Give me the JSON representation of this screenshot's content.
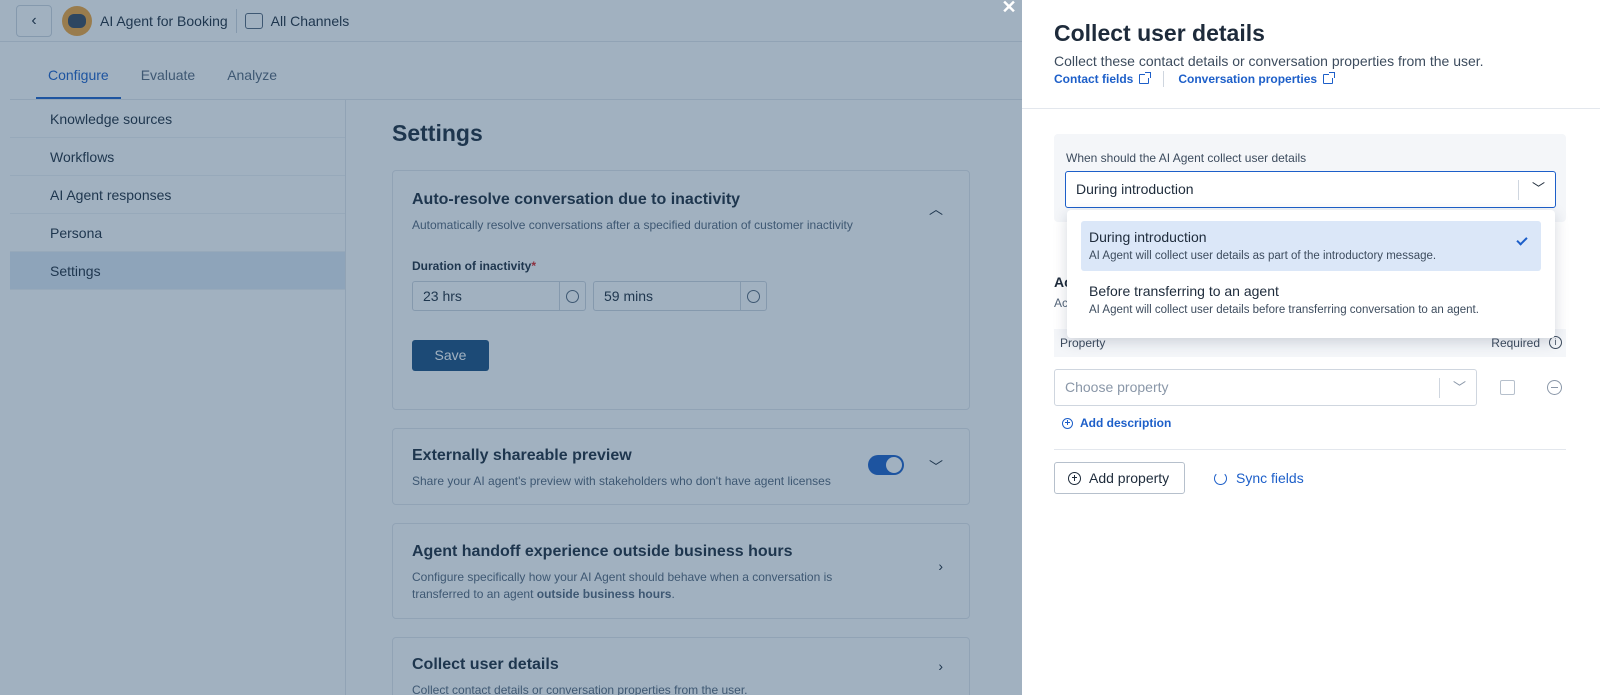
{
  "topbar": {
    "back_icon": "chevron-left-icon",
    "app_title": "AI Agent for Booking",
    "channel_label": "All Channels"
  },
  "tabs": [
    {
      "label": "Configure",
      "active": true
    },
    {
      "label": "Evaluate",
      "active": false
    },
    {
      "label": "Analyze",
      "active": false
    }
  ],
  "sidebar": {
    "items": [
      {
        "label": "Knowledge sources"
      },
      {
        "label": "Workflows"
      },
      {
        "label": "AI Agent responses"
      },
      {
        "label": "Persona"
      },
      {
        "label": "Settings",
        "active": true
      }
    ]
  },
  "settings": {
    "title": "Settings",
    "auto_resolve": {
      "title": "Auto-resolve conversation due to inactivity",
      "desc": "Automatically resolve conversations after a specified duration of customer inactivity",
      "duration_label": "Duration of inactivity",
      "required_mark": "*",
      "hours_value": "23 hrs",
      "mins_value": "59 mins",
      "save_label": "Save"
    },
    "shareable_preview": {
      "title": "Externally shareable preview",
      "desc": "Share your AI agent's preview with stakeholders who don't have agent licenses",
      "toggle_on": true
    },
    "handoff": {
      "title": "Agent handoff experience outside business hours",
      "desc_line1": "Configure specifically how your AI Agent should behave when a conversation is",
      "desc_line2_prefix": "transferred to an agent ",
      "desc_line2_bold": "outside business hours",
      "desc_line2_suffix": "."
    },
    "collect_card": {
      "title": "Collect user details",
      "desc": "Collect contact details or conversation properties from the user."
    }
  },
  "panel": {
    "close_label": "✕",
    "title": "Collect user details",
    "subtitle": "Collect these contact details or conversation properties from the user.",
    "links": [
      {
        "label": "Contact fields",
        "icon": "external-link-icon"
      },
      {
        "label": "Conversation properties",
        "icon": "external-link-icon"
      }
    ],
    "when_label": "When should the AI Agent collect user details",
    "when_value": "During introduction",
    "section_title": "Ac",
    "section_desc": "Ac",
    "property_header": "Property",
    "required_header": "Required",
    "choose_placeholder": "Choose property",
    "add_description": "Add description",
    "add_property": "Add property",
    "sync_fields": "Sync fields"
  },
  "dropdown": {
    "options": [
      {
        "title": "During introduction",
        "desc": "AI Agent will collect user details as part of the introductory message.",
        "selected": true
      },
      {
        "title": "Before transferring to an agent",
        "desc": "AI Agent will collect user details before transferring conversation to an agent.",
        "selected": false
      }
    ]
  },
  "colors": {
    "accent": "#1d5fc9",
    "primary_button": "#1b4f80",
    "overlay": "#204468",
    "selected_option_bg": "#dbe7f8"
  }
}
